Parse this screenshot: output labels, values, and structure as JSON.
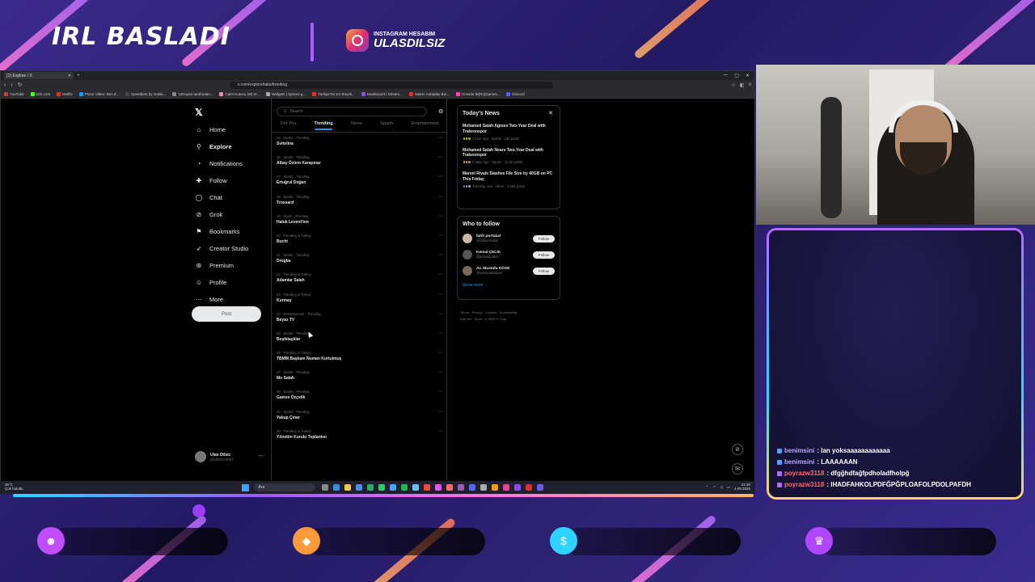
{
  "overlay": {
    "title": "IRL BASLADI",
    "instagram_label": "INSTAGRAM HESABIM",
    "instagram_handle": "ULASDILSIZ"
  },
  "browser": {
    "tab_title": "(1) Explore / X",
    "url": "x.com/explore/tabs/trending",
    "bookmarks": [
      "YouTube",
      "kick.com",
      "Netflix",
      "Prime Video: Ben d...",
      "Speedtest by Ookla...",
      "12Dopes tarafından...",
      "Calm Kutusu (M) Kl...",
      "Widgets | Sprees g...",
      "Türkiye'nin En Büyük...",
      "Dashboard / Stream...",
      "Salem Anbaday Bul...",
      "Ocesde Bi(Rs)Games...",
      "Discord"
    ]
  },
  "x": {
    "nav": [
      "Home",
      "Explore",
      "Notifications",
      "Follow",
      "Chat",
      "Grok",
      "Bookmarks",
      "Creator Studio",
      "Premium",
      "Profile",
      "More"
    ],
    "post_label": "Post",
    "account_name": "Ulas Dilsiz",
    "account_handle": "@UDilsiz4557",
    "search_placeholder": "Search",
    "tabs": [
      "For You",
      "Trending",
      "News",
      "Sports",
      "Entertainment"
    ],
    "trends": [
      {
        "meta": "15 · Sports · Trending",
        "name": "Svitolina"
      },
      {
        "meta": "16 · Sports · Trending",
        "name": "Albay Özlem Karapınar"
      },
      {
        "meta": "17 · Sports · Trending",
        "name": "Ertuğrul Doğan"
      },
      {
        "meta": "18 · Sports · Trending",
        "name": "Trossard"
      },
      {
        "meta": "19 · Music · Trending",
        "name": "Haluk Levent'ten"
      },
      {
        "meta": "20 · Trending in Turkey",
        "name": "Buchi"
      },
      {
        "meta": "21 · Sports · Trending",
        "name": "Drogba"
      },
      {
        "meta": "22 · Trending in Turkey",
        "name": "Adamlar Salah"
      },
      {
        "meta": "23 · Trending in Turkey",
        "name": "Kurmay"
      },
      {
        "meta": "24 · Entertainment · Trending",
        "name": "Beyaz TV"
      },
      {
        "meta": "25 · Sports · Trending",
        "name": "Beşiktaşlılar"
      },
      {
        "meta": "26 · Trending in Turkey",
        "name": "TBMM Başkanı Numan Kurtulmuş"
      },
      {
        "meta": "27 · Sports · Trending",
        "name": "Mo Salah"
      },
      {
        "meta": "28 · Sports · Trending",
        "name": "Gamze Özçelik"
      },
      {
        "meta": "29 · Sports · Trending",
        "name": "Yakup Çınar"
      },
      {
        "meta": "30 · Trending in Turkey",
        "name": "Yönetim Kurulu Toplantısı"
      }
    ],
    "news_title": "Today's News",
    "news": [
      {
        "title": "Mohamed Salah Agrees Two-Year Deal with Trabzonspor",
        "meta": "1 hour ago · Sports · 13K posts"
      },
      {
        "title": "Mohamed Salah Nears Two-Year Deal with Trabzonspor",
        "meta": "2 days ago · Sports · 32.2K posts"
      },
      {
        "title": "Marvel Rivals Slashes File Size by 40GB on PC This Friday",
        "meta": "Trending now · Other · 1,260 posts"
      }
    ],
    "who_to_follow_title": "Who to follow",
    "who_to_follow": [
      {
        "name": "fatih portakal",
        "handle": "@fatihportakal"
      },
      {
        "name": "Kemal ÇELİK",
        "handle": "@kemalcelik07"
      },
      {
        "name": "Av. Mustafa KÖSE",
        "handle": "@avmustafakose"
      }
    ],
    "follow_label": "Follow",
    "show_more": "Show more",
    "footer_line1": "Terms · Privacy · Cookies · Accessibility",
    "footer_line2": "Ads info · More · © 2025 X Corp."
  },
  "taskbar": {
    "weather": "26°C",
    "weather_desc": "Çok bulutlu",
    "search": "Ara",
    "time": "21:30",
    "date": "4.09.2025"
  },
  "chat": [
    {
      "user": "benimsini",
      "msg": ": lan yoksaaaaaaaaaaaa",
      "color": "blue"
    },
    {
      "user": "benimsini",
      "msg": ": LAAAAAAN",
      "color": "blue"
    },
    {
      "user": "poyrazw3118",
      "msg": ": dfgğhdfağfpdholadfholpğ",
      "color": "red"
    },
    {
      "user": "poyrazw3118",
      "msg": ": IHADFAHKOLPDFĞPĞPLOAFOLPDOLPAFDH",
      "color": "red"
    }
  ],
  "colors": {
    "accent": "#1d9bf0",
    "overlay_bg": "#2a1d5e",
    "chat_border_top": "#b46bff",
    "chat_border_bottom": "#ffd36b"
  }
}
